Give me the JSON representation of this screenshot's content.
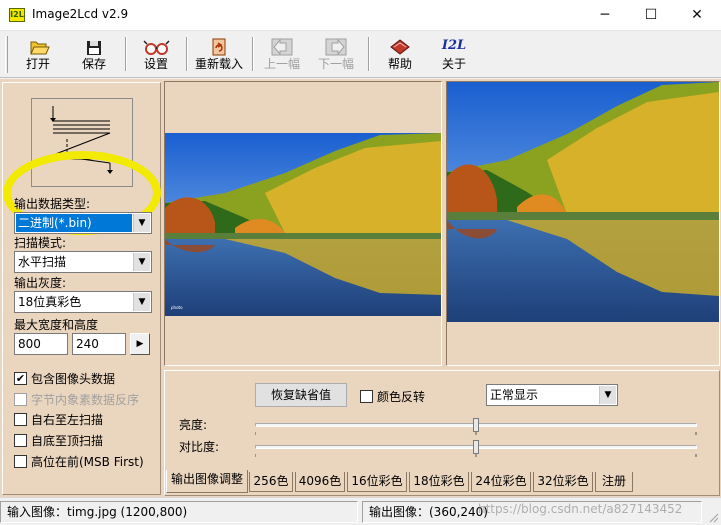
{
  "window": {
    "title": "Image2Lcd v2.9",
    "icon_text": "I2L",
    "minimize": "─",
    "maximize": "☐",
    "close": "✕"
  },
  "toolbar": {
    "open": "打开",
    "save": "保存",
    "settings": "设置",
    "reload": "重新载入",
    "prev": "上一幅",
    "next": "下一幅",
    "help": "帮助",
    "about": "关于",
    "about_icon_text": "I2L"
  },
  "left_panel": {
    "output_type_label": "输出数据类型:",
    "output_type_value": "二进制(*.bin)",
    "scan_mode_label": "扫描模式:",
    "scan_mode_value": "水平扫描",
    "grayscale_label": "输出灰度:",
    "grayscale_value": "18位真彩色",
    "max_size_label": "最大宽度和高度",
    "max_width": "800",
    "max_height": "240",
    "apply_button": "▶",
    "checkboxes": [
      {
        "label": "包含图像头数据",
        "checked": true,
        "enabled": true
      },
      {
        "label": "字节内象素数据反序",
        "checked": false,
        "enabled": false
      },
      {
        "label": "自右至左扫描",
        "checked": false,
        "enabled": true
      },
      {
        "label": "自底至顶扫描",
        "checked": false,
        "enabled": true
      },
      {
        "label": "高位在前(MSB First)",
        "checked": false,
        "enabled": true
      }
    ]
  },
  "preview": {
    "left_caption": "",
    "right_caption": ""
  },
  "adjust": {
    "restore_default": "恢复缺省值",
    "invert_colors": "颜色反转",
    "invert_checked": false,
    "display_mode": "正常显示",
    "brightness_label": "亮度:",
    "contrast_label": "对比度:",
    "brightness_value": 0.5,
    "contrast_value": 0.5
  },
  "tabs": [
    "输出图像调整",
    "256色",
    "4096色",
    "16位彩色",
    "18位彩色",
    "24位彩色",
    "32位彩色",
    "注册"
  ],
  "status": {
    "input_image": "输入图像：timg.jpg (1200,800)",
    "output_image": "输出图像：(360,240)",
    "watermark": "https://blog.csdn.net/a827143452"
  },
  "colors": {
    "client_bg": "#ead5bf",
    "highlight": "#f2ea00",
    "selection": "#0078d7"
  }
}
